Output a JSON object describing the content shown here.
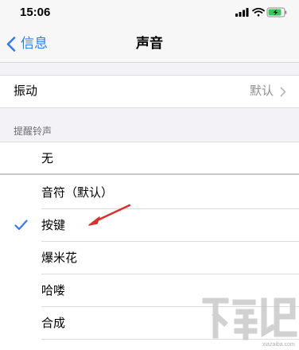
{
  "status_bar": {
    "time": "15:06",
    "icons": [
      "signal-icon",
      "wifi-icon",
      "battery-charging-icon"
    ]
  },
  "nav": {
    "back_label": "信息",
    "title": "声音"
  },
  "vibration": {
    "label": "振动",
    "value": "默认"
  },
  "ringtone_section": {
    "header": "提醒铃声",
    "items": [
      {
        "label": "无",
        "selected": false
      },
      {
        "label": "音符（默认）",
        "selected": false
      },
      {
        "label": "按键",
        "selected": true
      },
      {
        "label": "爆米花",
        "selected": false
      },
      {
        "label": "哈喽",
        "selected": false
      },
      {
        "label": "合成",
        "selected": false
      }
    ]
  },
  "watermark": {
    "text": "xiazaiba.com"
  },
  "colors": {
    "accent": "#2f7cf6",
    "background": "#f2f2f7",
    "annotation_arrow": "#d9302b"
  }
}
